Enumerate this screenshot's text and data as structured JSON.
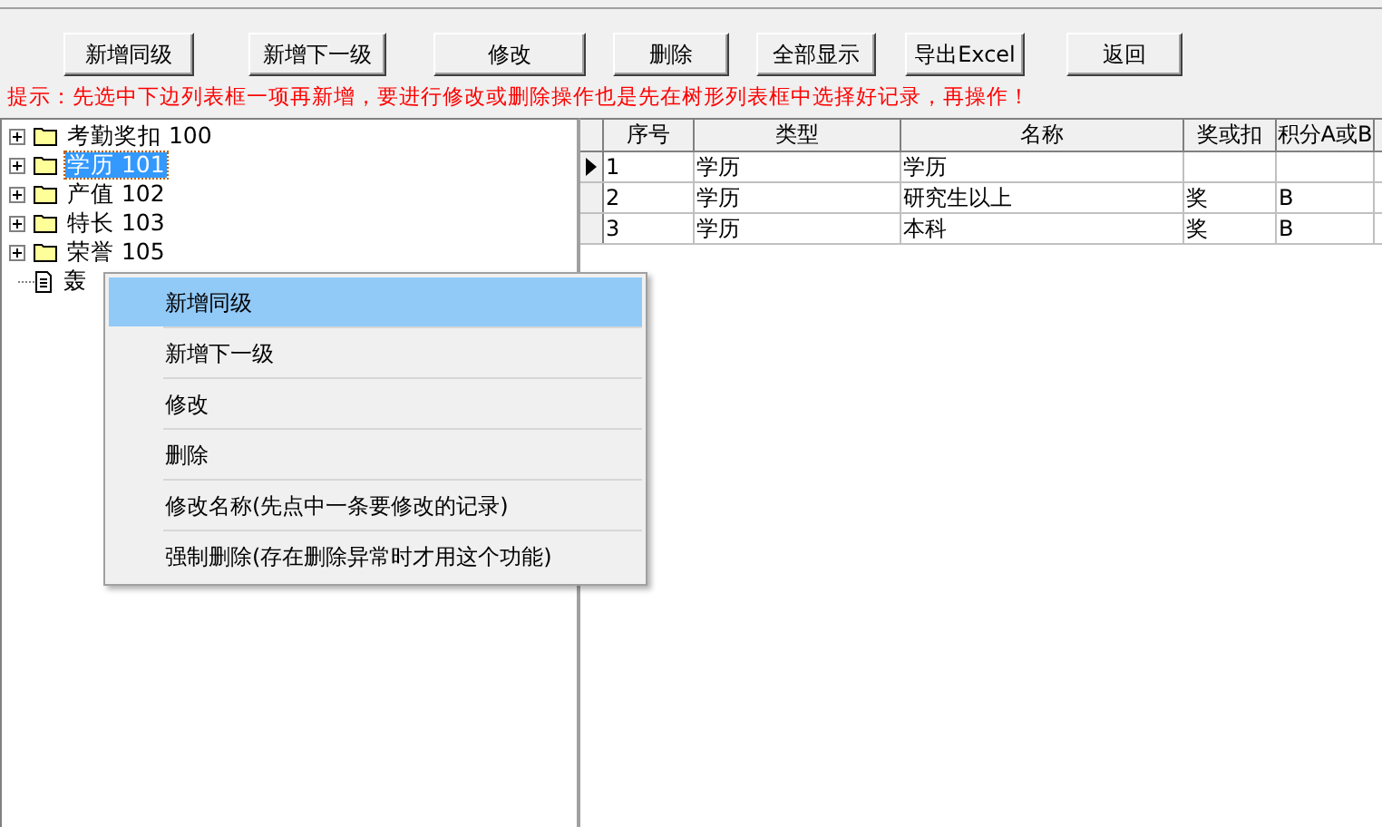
{
  "toolbar": {
    "buttons": [
      "新增同级",
      "新增下一级",
      "修改",
      "删除",
      "全部显示",
      "导出Excel",
      "返回"
    ]
  },
  "hint": "提示：先选中下边列表框一项再新增，要进行修改或删除操作也是先在树形列表框中选择好记录，再操作！",
  "tree": {
    "items": [
      {
        "label": "考勤奖扣 100",
        "kind": "folder",
        "selected": false
      },
      {
        "label": "学历 101",
        "kind": "folder",
        "selected": true
      },
      {
        "label": "产值 102",
        "kind": "folder",
        "selected": false
      },
      {
        "label": "特长 103",
        "kind": "folder",
        "selected": false
      },
      {
        "label": "荣誉 105",
        "kind": "folder",
        "selected": false
      },
      {
        "label": "轰",
        "kind": "document",
        "selected": false
      }
    ]
  },
  "table": {
    "columns": [
      "序号",
      "类型",
      "名称",
      "奖或扣",
      "积分A或B"
    ],
    "rows": [
      {
        "cells": [
          "1",
          "学历",
          "学历",
          "",
          ""
        ],
        "selected": true
      },
      {
        "cells": [
          "2",
          "学历",
          "研究生以上",
          "奖",
          "B"
        ],
        "selected": false
      },
      {
        "cells": [
          "3",
          "学历",
          "本科",
          "奖",
          "B"
        ],
        "selected": false
      }
    ]
  },
  "context_menu": {
    "items": [
      {
        "label": "新增同级",
        "selected": true
      },
      {
        "label": "新增下一级",
        "selected": false
      },
      {
        "label": "修改",
        "selected": false
      },
      {
        "label": "删除",
        "selected": false
      },
      {
        "label": "修改名称(先点中一条要修改的记录)",
        "selected": false
      },
      {
        "label": "强制删除(存在删除异常时才用这个功能)",
        "selected": false
      }
    ]
  }
}
